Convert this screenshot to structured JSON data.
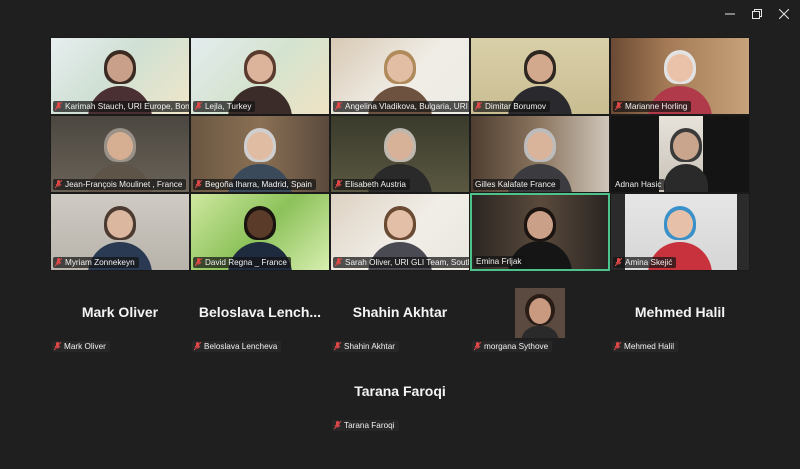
{
  "window_controls": {
    "minimize": "minimize-icon",
    "restore": "restore-icon",
    "close": "close-icon"
  },
  "colors": {
    "background": "#1f1f1f",
    "active_speaker_border": "#4cc38a",
    "muted_mic": "#e04848"
  },
  "video_tiles": [
    {
      "name": "Karimah Stauch, URI Europe, Bonn, G...",
      "muted": true
    },
    {
      "name": "Lejla, Turkey",
      "muted": true
    },
    {
      "name": "Angelina Vladikova, Bulgaria, URI",
      "muted": true
    },
    {
      "name": "Dimitar Borumov",
      "muted": true
    },
    {
      "name": "Marianne Horling",
      "muted": true
    },
    {
      "name": "Jean-François Moulinet , France",
      "muted": true
    },
    {
      "name": "Begoña Iharra, Madrid, Spain",
      "muted": true
    },
    {
      "name": "Elisabeth Austria",
      "muted": true
    },
    {
      "name": "Gilles Kalafate France",
      "muted": false
    },
    {
      "name": "Adnan Hasic",
      "muted": false
    },
    {
      "name": "Myriam Zonnekeyn",
      "muted": true
    },
    {
      "name": "David Regna _ France",
      "muted": true
    },
    {
      "name": "Sarah Oliver, URI GLI Team, South ...",
      "muted": true
    },
    {
      "name": "Emina Frljak",
      "muted": false,
      "speaking": true
    },
    {
      "name": "Amina Skejić",
      "muted": true
    }
  ],
  "audio_tiles": [
    {
      "display": "Mark Oliver",
      "name": "Mark Oliver"
    },
    {
      "display": "Beloslava  Lench...",
      "name": "Beloslava Lencheva"
    },
    {
      "display": "Shahin Akhtar",
      "name": "Shahin Akhtar"
    },
    {
      "display": "",
      "name": "morgana Sythove"
    },
    {
      "display": "Mehmed Halil",
      "name": "Mehmed Halil"
    },
    {
      "display": "Tarana Faroqi",
      "name": "Tarana Faroqi"
    }
  ]
}
